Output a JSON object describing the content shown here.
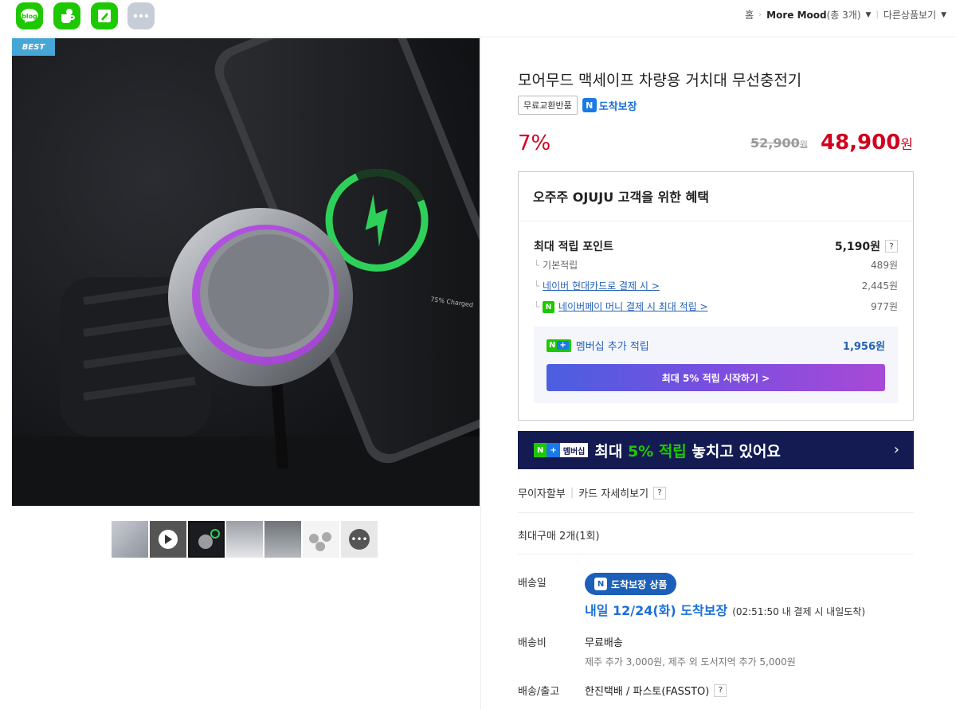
{
  "sns": [
    {
      "name": "blog",
      "label": "blog"
    },
    {
      "name": "talk"
    },
    {
      "name": "pen"
    },
    {
      "name": "more"
    }
  ],
  "breadcrumb": {
    "home": "홈",
    "store": "More Mood",
    "store_count": "(총 3개)",
    "other": "다른상품보기"
  },
  "image": {
    "best_badge": "BEST",
    "thumbnail_count": 7
  },
  "product": {
    "title": "모어무드 맥세이프 차량용 거치대 무선충전기",
    "tag_free_return": "무료교환반품",
    "tag_arrival": "도착보장",
    "discount": "7%",
    "original_price": "52,900",
    "original_unit": "원",
    "sale_price": "48,900",
    "sale_unit": "원"
  },
  "benefit": {
    "header": "오주주 OJUJU 고객을 위한 혜택",
    "max_points_label": "최대 적립 포인트",
    "max_points_value": "5,190원",
    "basic_label": "기본적립",
    "basic_value": "489원",
    "card_label": "네이버 현대카드로 결제 시 >",
    "card_value": "2,445원",
    "pay_label": "네이버페이 머니 결제 시 최대 적립 >",
    "pay_value": "977원",
    "member_label": "멤버십 추가 적립",
    "member_value": "1,956원",
    "member_button": "최대 5% 적립 시작하기 >"
  },
  "banner": {
    "badge_n": "N",
    "badge_plus": "+",
    "badge_member": "멤버십",
    "text_prefix": "최대 ",
    "text_highlight": "5% 적립",
    "text_suffix": " 놓치고 있어요",
    "arrow": "›"
  },
  "installment": {
    "label": "무이자할부",
    "link": "카드 자세히보기"
  },
  "max_purchase": "최대구매 2개(1회)",
  "shipping": {
    "date_label": "배송일",
    "arrival_badge": "도착보장 상품",
    "arrival_big": "내일 12/24(화) 도착보장",
    "arrival_small": "(02:51:50 내 결제 시 내일도착)",
    "fee_label": "배송비",
    "fee_value": "무료배송",
    "fee_note": "제주 추가 3,000원, 제주 외 도서지역 추가 5,000원",
    "carrier_label": "배송/출고",
    "carrier_value": "한진택배 / 파스토(FASSTO)"
  },
  "colors": {
    "price_red": "#d2001f",
    "naver_green": "#1ec800",
    "link_blue": "#2761b8",
    "banner_navy": "#141b52"
  }
}
